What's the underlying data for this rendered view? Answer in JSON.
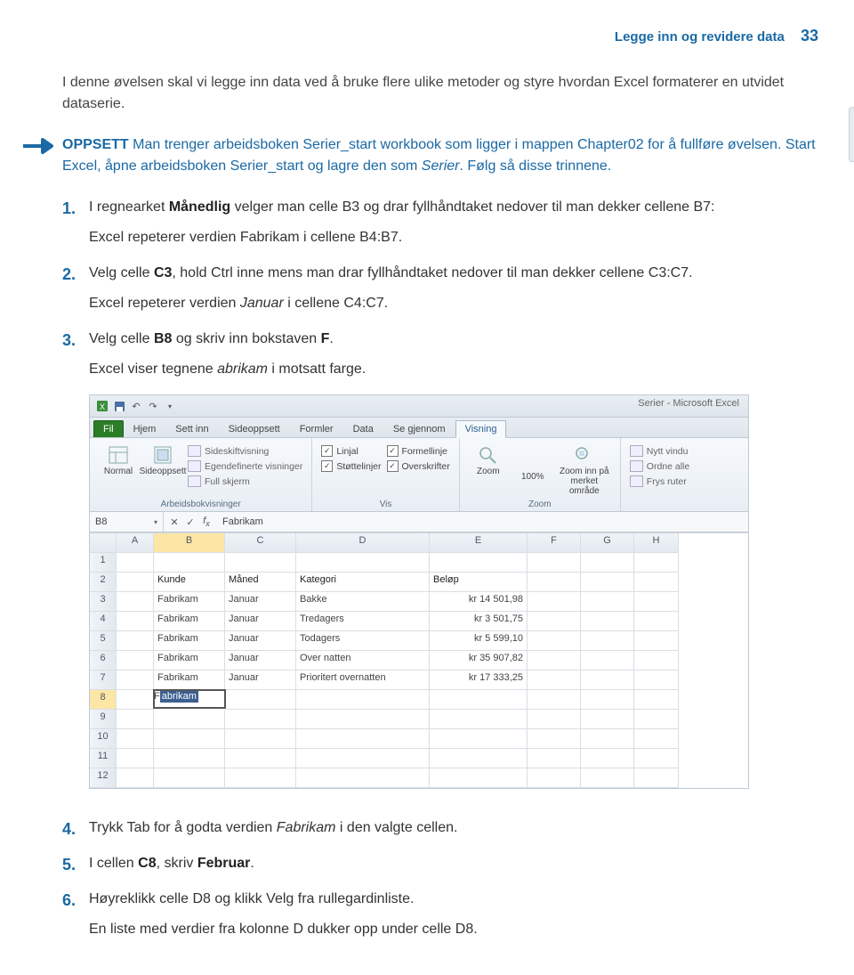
{
  "header": {
    "title": "Legge inn og revidere data",
    "page": "33"
  },
  "intro": "I denne øvelsen skal vi legge inn data ved å bruke flere ulike metoder og styre hvordan Excel formaterer en utvidet dataserie.",
  "setup": {
    "label": "OPPSETT",
    "text_a": "Man trenger arbeidsboken Serier_start workbook som ligger i mappen Chapter02 for å fullføre øvelsen. Start Excel, åpne arbeidsboken Serier_start og lagre den som ",
    "em": "Serier",
    "text_b": ". Følg så disse trinnene."
  },
  "steps": [
    {
      "main_parts": [
        "I regnearket ",
        {
          "b": "Månedlig"
        },
        " velger man celle B3 og drar fyllhåndtaket nedover til man dekker cellene B7:"
      ],
      "sub": [
        "Excel repeterer verdien Fabrikam i cellene B4:B7."
      ]
    },
    {
      "main_parts": [
        "Velg celle ",
        {
          "b": "C3"
        },
        ", hold Ctrl inne mens man drar fyllhåndtaket nedover til man dekker cellene C3:C7."
      ],
      "sub": [
        "Excel repeterer verdien ",
        {
          "em": "Januar"
        },
        " i cellene C4:C7."
      ]
    },
    {
      "main_parts": [
        "Velg celle ",
        {
          "b": "B8"
        },
        " og skriv inn bokstaven ",
        {
          "b": "F"
        },
        "."
      ],
      "sub": [
        "Excel viser tegnene ",
        {
          "em": "abrikam"
        },
        " i motsatt farge."
      ]
    },
    {
      "main_parts": [
        "Trykk Tab for å godta verdien ",
        {
          "em": "Fabrikam"
        },
        " i den valgte cellen."
      ]
    },
    {
      "main_parts": [
        "I cellen ",
        {
          "b": "C8"
        },
        ", skriv ",
        {
          "b": "Februar"
        },
        "."
      ]
    },
    {
      "main_parts": [
        "Høyreklikk celle D8 og klikk Velg fra rullegardinliste."
      ],
      "sub": [
        "En liste med verdier fra kolonne D dukker opp under celle D8."
      ]
    }
  ],
  "excel": {
    "window_title": "Serier - Microsoft Excel",
    "tabs": [
      "Fil",
      "Hjem",
      "Sett inn",
      "Sideoppsett",
      "Formler",
      "Data",
      "Se gjennom",
      "Visning"
    ],
    "active_tab": "Visning",
    "group_views": {
      "label": "Arbeidsbokvisninger",
      "normal": "Normal",
      "sideoppsett": "Sideoppsett",
      "items": [
        "Sideskiftvisning",
        "Egendefinerte visninger",
        "Full skjerm"
      ]
    },
    "group_show": {
      "label": "Vis",
      "checks": [
        {
          "label": "Linjal",
          "checked": true
        },
        {
          "label": "Formellinje",
          "checked": true
        },
        {
          "label": "Støttelinjer",
          "checked": true
        },
        {
          "label": "Overskrifter",
          "checked": true
        }
      ]
    },
    "group_zoom": {
      "label": "Zoom",
      "zoom": "Zoom",
      "hundred": "100%",
      "zoom_sel": "Zoom inn på merket område"
    },
    "group_window": {
      "items": [
        "Nytt vindu",
        "Ordne alle",
        "Frys ruter"
      ]
    },
    "namebox": "B8",
    "fx_value": "Fabrikam",
    "columns": [
      "",
      "A",
      "B",
      "C",
      "D",
      "E",
      "F",
      "G",
      "H"
    ],
    "active_col_index": 2,
    "rows": [
      {
        "n": "1",
        "cells": [
          "",
          "",
          "",
          "",
          "",
          "",
          "",
          ""
        ]
      },
      {
        "n": "2",
        "cells": [
          "",
          "Kunde",
          "Måned",
          "Kategori",
          "Beløp",
          "",
          "",
          ""
        ],
        "hdr": true
      },
      {
        "n": "3",
        "cells": [
          "",
          "Fabrikam",
          "Januar",
          "Bakke",
          "kr 14 501,98",
          "",
          "",
          ""
        ]
      },
      {
        "n": "4",
        "cells": [
          "",
          "Fabrikam",
          "Januar",
          "Tredagers",
          "kr 3 501,75",
          "",
          "",
          ""
        ]
      },
      {
        "n": "5",
        "cells": [
          "",
          "Fabrikam",
          "Januar",
          "Todagers",
          "kr 5 599,10",
          "",
          "",
          ""
        ]
      },
      {
        "n": "6",
        "cells": [
          "",
          "Fabrikam",
          "Januar",
          "Over natten",
          "kr 35 907,82",
          "",
          "",
          ""
        ]
      },
      {
        "n": "7",
        "cells": [
          "",
          "Fabrikam",
          "Januar",
          "Prioritert overnatten",
          "kr 17 333,25",
          "",
          "",
          ""
        ]
      },
      {
        "n": "8",
        "cells": [
          "",
          "__EDIT__",
          "",
          "",
          "",
          "",
          "",
          ""
        ],
        "active": true,
        "edit": {
          "typed": "F",
          "rest": "abrikam"
        }
      },
      {
        "n": "9",
        "cells": [
          "",
          "",
          "",
          "",
          "",
          "",
          "",
          ""
        ]
      },
      {
        "n": "10",
        "cells": [
          "",
          "",
          "",
          "",
          "",
          "",
          "",
          ""
        ]
      },
      {
        "n": "11",
        "cells": [
          "",
          "",
          "",
          "",
          "",
          "",
          "",
          ""
        ]
      },
      {
        "n": "12",
        "cells": [
          "",
          "",
          "",
          "",
          "",
          "",
          "",
          ""
        ]
      }
    ]
  }
}
